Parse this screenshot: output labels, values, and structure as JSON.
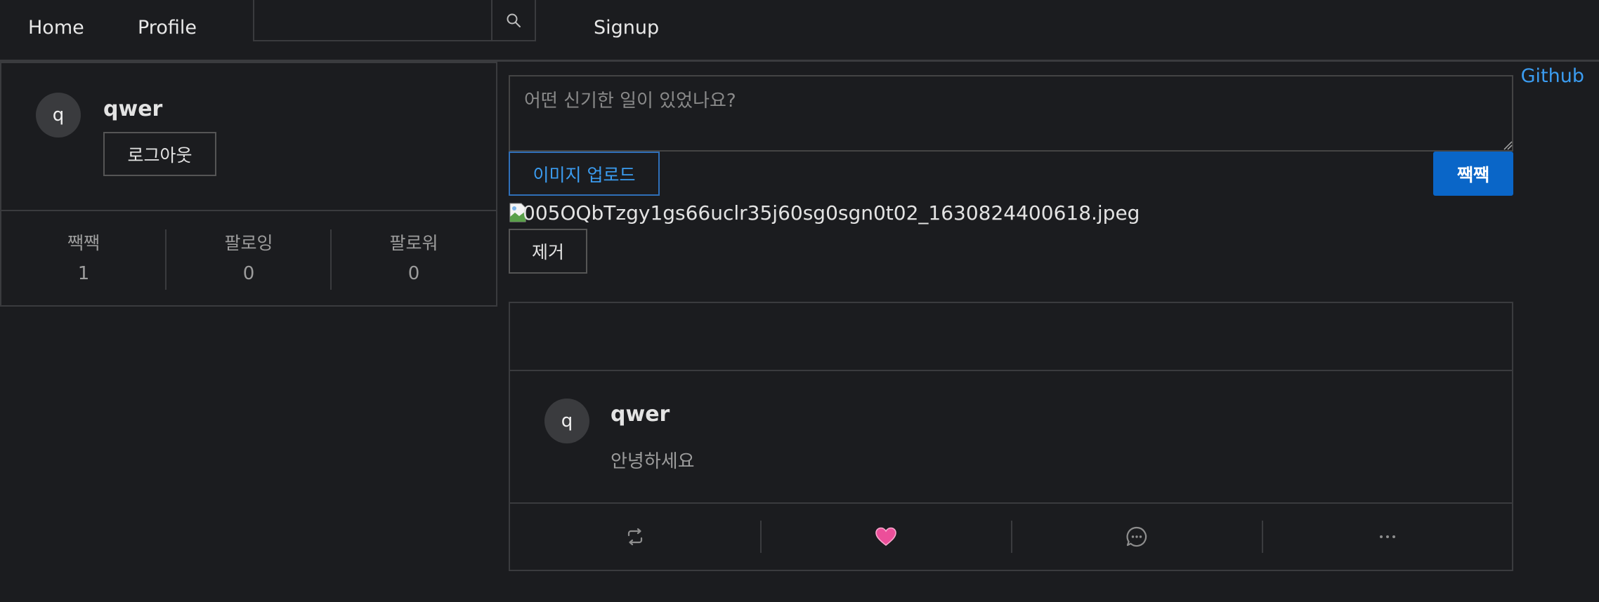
{
  "nav": {
    "home": "Home",
    "profile": "Profile",
    "signup": "Signup",
    "search_value": "",
    "search_icon": "search-icon"
  },
  "github_link": "Github",
  "profile": {
    "avatar_letter": "q",
    "username": "qwer",
    "logout_label": "로그아웃",
    "stats": [
      {
        "label": "짹짹",
        "value": "1"
      },
      {
        "label": "팔로잉",
        "value": "0"
      },
      {
        "label": "팔로워",
        "value": "0"
      }
    ]
  },
  "compose": {
    "placeholder": "어떤 신기한 일이 있었나요?",
    "upload_label": "이미지 업로드",
    "submit_label": "짹짹",
    "file_name": "005OQbTzgy1gs66uclr35j60sg0sgn0t02_1630824400618.jpeg",
    "remove_label": "제거"
  },
  "post": {
    "avatar_letter": "q",
    "username": "qwer",
    "text": "안녕하세요",
    "actions": [
      "retweet-icon",
      "heart-icon",
      "comment-icon",
      "more-icon"
    ]
  },
  "colors": {
    "background": "#1b1c1f",
    "accent": "#0a66c8",
    "link": "#3b9cf0",
    "heart": "#ec4f9a",
    "border": "#3a3b3e"
  }
}
